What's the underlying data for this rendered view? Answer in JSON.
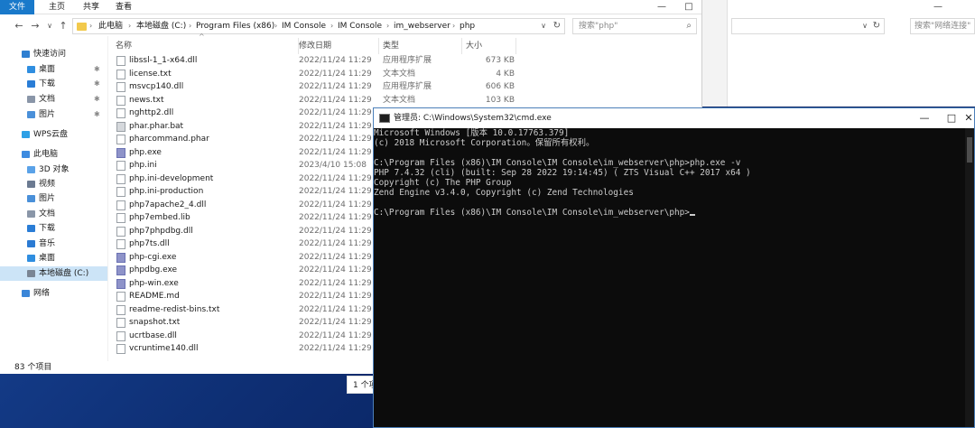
{
  "explorer": {
    "ribbon_tabs": [
      "文件",
      "主页",
      "共享",
      "查看"
    ],
    "window_controls": [
      "—",
      "□"
    ],
    "address_parts": [
      "此电脑",
      "本地磁盘 (C:)",
      "Program Files (x86)",
      "IM Console",
      "IM Console",
      "im_webserver",
      "php"
    ],
    "search_placeholder": "搜索\"php\"",
    "nav_back": "←",
    "nav_forward": "→",
    "nav_dropdown": "∨",
    "nav_up": "↑",
    "refresh": "↻",
    "sidebar": [
      {
        "label": "快速访问",
        "icon": "star-icon",
        "pinned": false
      },
      {
        "label": "桌面",
        "icon": "desktop-icon",
        "pinned": true
      },
      {
        "label": "下载",
        "icon": "download-icon",
        "pinned": true
      },
      {
        "label": "文档",
        "icon": "document-icon",
        "pinned": true
      },
      {
        "label": "图片",
        "icon": "picture-icon",
        "pinned": true
      },
      {
        "label": "WPS云盘",
        "icon": "cloud-icon",
        "pinned": false
      },
      {
        "label": "此电脑",
        "icon": "computer-icon",
        "pinned": false
      },
      {
        "label": "3D 对象",
        "icon": "3d-objects-icon",
        "pinned": false
      },
      {
        "label": "视频",
        "icon": "video-icon",
        "pinned": false
      },
      {
        "label": "图片",
        "icon": "picture-icon",
        "pinned": false
      },
      {
        "label": "文档",
        "icon": "document-icon",
        "pinned": false
      },
      {
        "label": "下载",
        "icon": "download-icon",
        "pinned": false
      },
      {
        "label": "音乐",
        "icon": "music-icon",
        "pinned": false
      },
      {
        "label": "桌面",
        "icon": "desktop-icon",
        "pinned": false
      },
      {
        "label": "本地磁盘 (C:)",
        "icon": "drive-icon",
        "pinned": false,
        "selected": true
      },
      {
        "label": "网络",
        "icon": "network-icon",
        "pinned": false
      }
    ],
    "columns": [
      "名称",
      "修改日期",
      "类型",
      "大小"
    ],
    "files": [
      {
        "name": "libssl-1_1-x64.dll",
        "date": "2022/11/24 11:29",
        "type": "应用程序扩展",
        "size": "673 KB",
        "kind": "dll"
      },
      {
        "name": "license.txt",
        "date": "2022/11/24 11:29",
        "type": "文本文档",
        "size": "4 KB",
        "kind": "txt"
      },
      {
        "name": "msvcp140.dll",
        "date": "2022/11/24 11:29",
        "type": "应用程序扩展",
        "size": "606 KB",
        "kind": "dll"
      },
      {
        "name": "news.txt",
        "date": "2022/11/24 11:29",
        "type": "文本文档",
        "size": "103 KB",
        "kind": "txt"
      },
      {
        "name": "nghttp2.dll",
        "date": "2022/11/24 11:29",
        "type": "",
        "size": "",
        "kind": "dll"
      },
      {
        "name": "phar.phar.bat",
        "date": "2022/11/24 11:29",
        "type": "",
        "size": "",
        "kind": "bat"
      },
      {
        "name": "pharcommand.phar",
        "date": "2022/11/24 11:29",
        "type": "",
        "size": "",
        "kind": "txt"
      },
      {
        "name": "php.exe",
        "date": "2022/11/24 11:29",
        "type": "",
        "size": "",
        "kind": "exe"
      },
      {
        "name": "php.ini",
        "date": "2023/4/10 15:08",
        "type": "",
        "size": "",
        "kind": "txt"
      },
      {
        "name": "php.ini-development",
        "date": "2022/11/24 11:29",
        "type": "",
        "size": "",
        "kind": "txt"
      },
      {
        "name": "php.ini-production",
        "date": "2022/11/24 11:29",
        "type": "",
        "size": "",
        "kind": "txt"
      },
      {
        "name": "php7apache2_4.dll",
        "date": "2022/11/24 11:29",
        "type": "",
        "size": "",
        "kind": "dll"
      },
      {
        "name": "php7embed.lib",
        "date": "2022/11/24 11:29",
        "type": "",
        "size": "",
        "kind": "txt"
      },
      {
        "name": "php7phpdbg.dll",
        "date": "2022/11/24 11:29",
        "type": "",
        "size": "",
        "kind": "dll"
      },
      {
        "name": "php7ts.dll",
        "date": "2022/11/24 11:29",
        "type": "",
        "size": "",
        "kind": "dll"
      },
      {
        "name": "php-cgi.exe",
        "date": "2022/11/24 11:29",
        "type": "",
        "size": "",
        "kind": "exe"
      },
      {
        "name": "phpdbg.exe",
        "date": "2022/11/24 11:29",
        "type": "",
        "size": "",
        "kind": "exe"
      },
      {
        "name": "php-win.exe",
        "date": "2022/11/24 11:29",
        "type": "",
        "size": "",
        "kind": "exe"
      },
      {
        "name": "README.md",
        "date": "2022/11/24 11:29",
        "type": "",
        "size": "",
        "kind": "txt"
      },
      {
        "name": "readme-redist-bins.txt",
        "date": "2022/11/24 11:29",
        "type": "",
        "size": "",
        "kind": "txt"
      },
      {
        "name": "snapshot.txt",
        "date": "2022/11/24 11:29",
        "type": "",
        "size": "",
        "kind": "txt"
      },
      {
        "name": "ucrtbase.dll",
        "date": "2022/11/24 11:29",
        "type": "",
        "size": "",
        "kind": "dll"
      },
      {
        "name": "vcruntime140.dll",
        "date": "2022/11/24 11:29",
        "type": "",
        "size": "",
        "kind": "dll"
      }
    ],
    "status_count": "83 个项目",
    "status_selected": "1 个项"
  },
  "explorer2": {
    "search_placeholder": "搜索\"网络连接\"",
    "refresh": "↻",
    "dropdown": "∨",
    "window_controls": [
      "—"
    ]
  },
  "cmd": {
    "title": "管理员: C:\\Windows\\System32\\cmd.exe",
    "controls": [
      "—",
      "□",
      "✕"
    ],
    "lines": [
      "Microsoft Windows [版本 10.0.17763.379]",
      "(c) 2018 Microsoft Corporation。保留所有权利。",
      "",
      "C:\\Program Files (x86)\\IM Console\\IM Console\\im_webserver\\php>php.exe -v",
      "PHP 7.4.32 (cli) (built: Sep 28 2022 19:14:45) ( ZTS Visual C++ 2017 x64 )",
      "Copyright (c) The PHP Group",
      "Zend Engine v3.4.0, Copyright (c) Zend Technologies",
      "",
      "C:\\Program Files (x86)\\IM Console\\IM Console\\im_webserver\\php>"
    ]
  },
  "colors": {
    "ribbon_file_tab": "#1979ca",
    "selection": "#cce4f7",
    "cmd_bg": "#0c0c0c",
    "cmd_text": "#cccccc",
    "desktop": "#16377a"
  }
}
